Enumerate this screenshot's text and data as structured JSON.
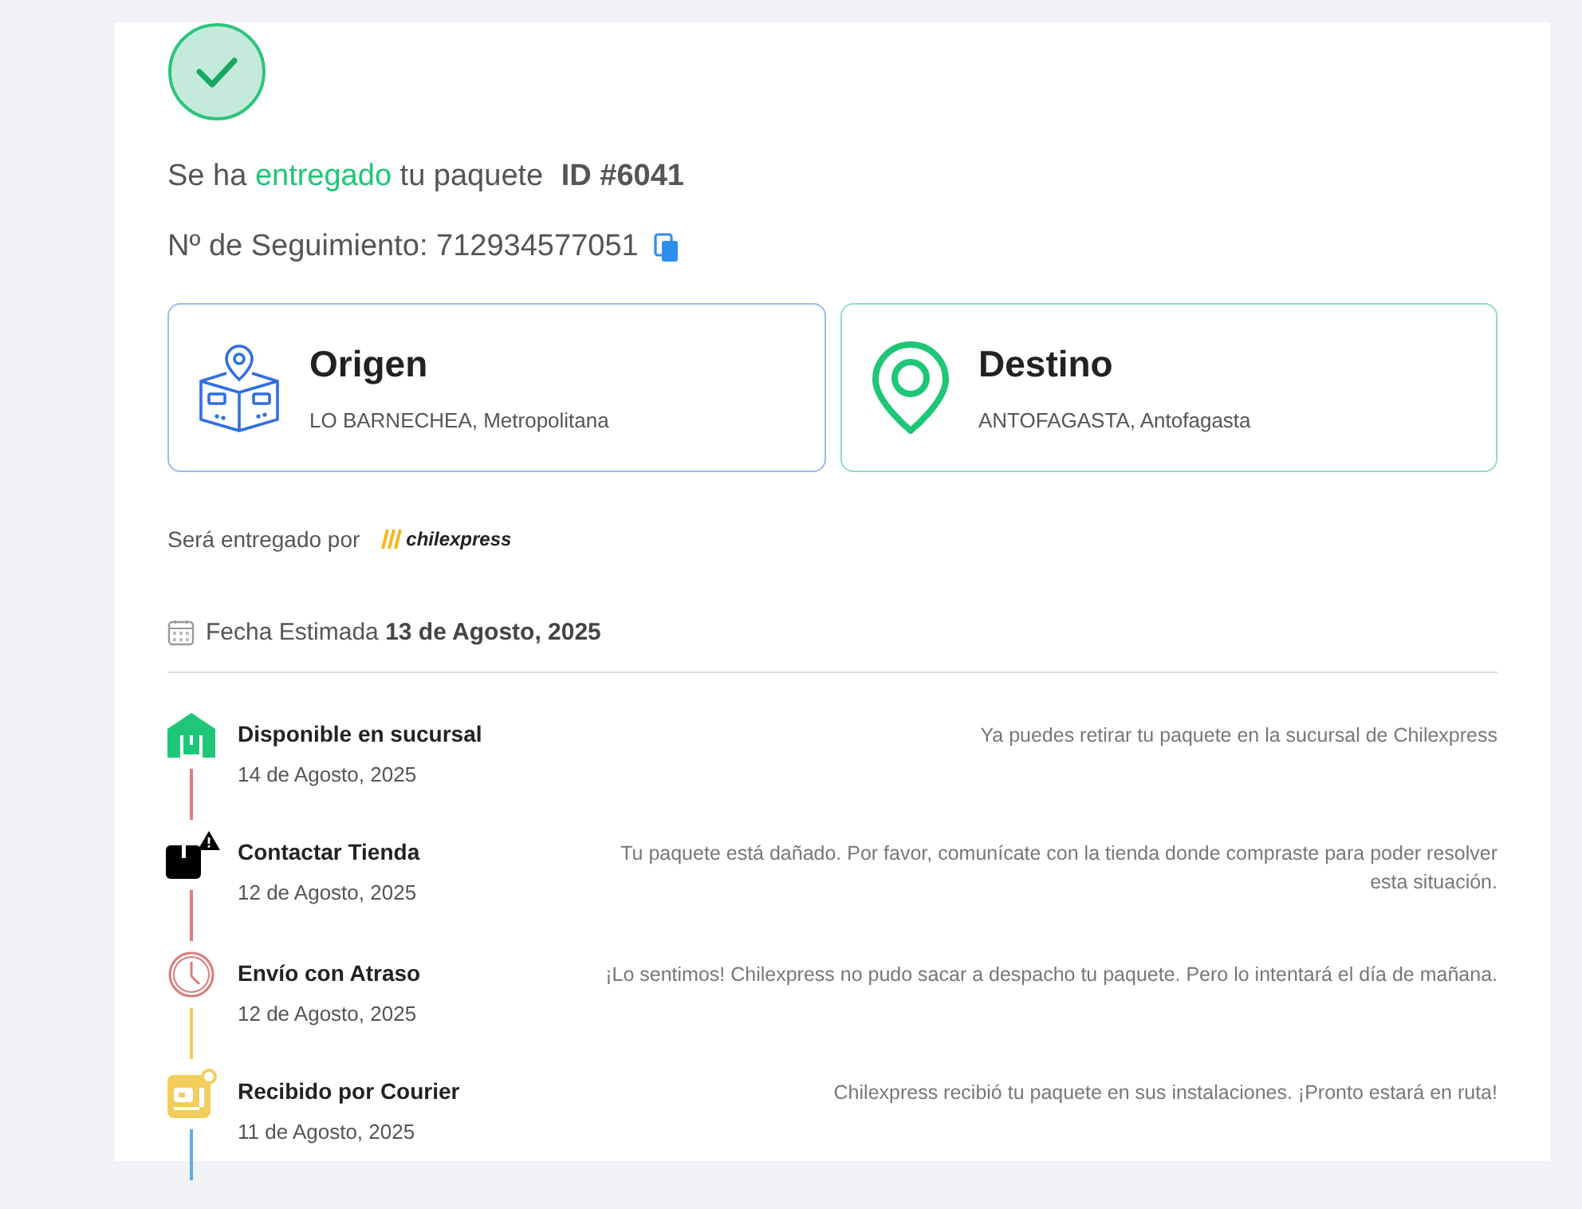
{
  "status": {
    "prefix": "Se ha",
    "word": "entregado",
    "suffix": "tu paquete",
    "id": "ID #6041"
  },
  "tracking": {
    "label": "Nº de Seguimiento: 712934577051"
  },
  "locations": [
    {
      "kind": "origin",
      "title": "Origen",
      "place": "LO BARNECHEA, Metropolitana"
    },
    {
      "kind": "destination",
      "title": "Destino",
      "place": "ANTOFAGASTA, Antofagasta"
    }
  ],
  "carrier": {
    "label": "Será entregado por",
    "name": "chilexpress"
  },
  "estimate": "Fecha Estimada **13 de Agosto, 2025**",
  "events": [
    {
      "kind": "branch",
      "title": "Disponible en sucursal",
      "date": "14 de Agosto, 2025",
      "description": "Ya puedes retirar tu paquete en la sucursal de Chilexpress",
      "color": "#e07a7a"
    },
    {
      "kind": "alert",
      "title": "Contactar Tienda",
      "date": "12 de Agosto, 2025",
      "description": "Tu paquete está dañado. Por favor, comunícate con la tienda donde compraste para poder resolver esta situación.",
      "color": "#e07a7a"
    },
    {
      "kind": "delay",
      "title": "Envío con Atraso",
      "date": "12 de Agosto, 2025",
      "description": "¡Lo sentimos! Chilexpress no pudo sacar a despacho tu paquete. Pero lo intentará el día de mañana.",
      "color": "#f2cd5c"
    },
    {
      "kind": "courier",
      "title": "Recibido por Courier",
      "date": "11 de Agosto, 2025",
      "description": "Chilexpress recibió tu paquete en sus instalaciones. ¡Pronto estará en ruta!",
      "color": "#5aaef0"
    }
  ]
}
